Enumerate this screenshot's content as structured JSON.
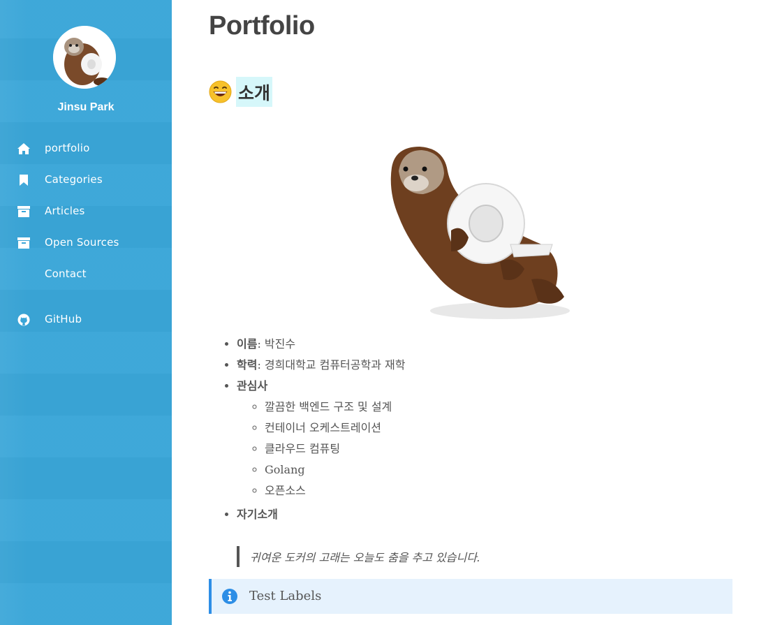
{
  "sidebar": {
    "author": "Jinsu Park",
    "items": [
      {
        "label": "portfolio",
        "icon": "home-icon"
      },
      {
        "label": "Categories",
        "icon": "bookmark-icon"
      },
      {
        "label": "Articles",
        "icon": "archive-icon"
      },
      {
        "label": "Open Sources",
        "icon": "archive-icon"
      },
      {
        "label": "Contact",
        "icon": ""
      },
      {
        "label": "GitHub",
        "icon": "github-icon"
      }
    ],
    "colors": {
      "background": "#3aa6d8",
      "text": "#ffffff"
    }
  },
  "main": {
    "title": "Portfolio",
    "section_emoji": "grinning-face-icon",
    "section_title": "소개",
    "info": {
      "name_label": "이름",
      "name_value": ": 박진수",
      "edu_label": "학력",
      "edu_value": ": 경희대학교 컴퓨터공학과 재학",
      "interest_label": "관심사",
      "interests": [
        "깔끔한 백엔드 구조 및 설계",
        "컨테이너 오케스트레이션",
        "클라우드 컴퓨팅",
        "Golang",
        "오픈소스"
      ],
      "intro_label": "자기소개"
    },
    "quote": "귀여운 도커의 고래는 오늘도 춤을 추고 있습니다.",
    "notice": {
      "text": "Test Labels",
      "icon": "info-circle-icon"
    },
    "colors": {
      "highlight": "#d6f7fa",
      "notice_bg": "#e6f2fd",
      "notice_border": "#2d8ee6"
    }
  }
}
